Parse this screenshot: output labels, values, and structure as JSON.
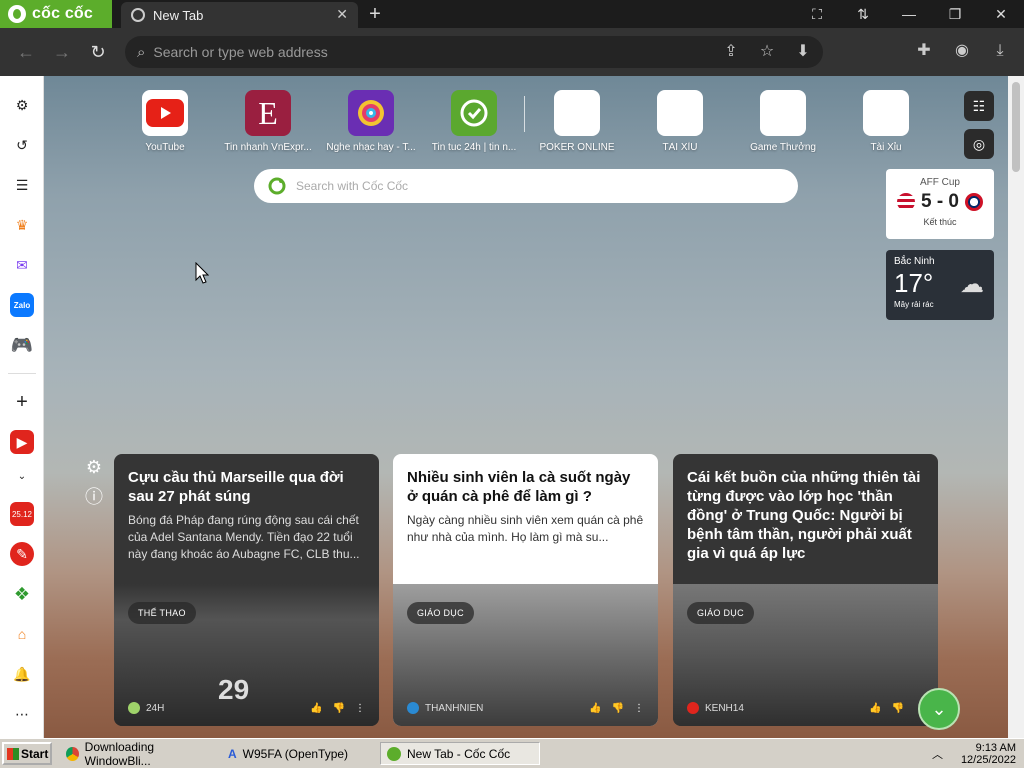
{
  "browser": {
    "brand": "cốc cốc",
    "tab_title": "New Tab",
    "tab_close": "✕",
    "new_tab": "+",
    "omnibox_placeholder": "Search or type web address"
  },
  "shortcuts": [
    {
      "label": "YouTube",
      "icon": "youtube-icon",
      "color": "#e62117"
    },
    {
      "label": "Tin nhanh VnExpr...",
      "icon": "vnexpress-icon",
      "color": "#9a1f40"
    },
    {
      "label": "Nghe nhạc hay - T...",
      "icon": "music-icon",
      "color": "#6a2eb3"
    },
    {
      "label": "Tin tuc 24h | tin n...",
      "icon": "news24h-icon",
      "color": "#5ba82f"
    },
    {
      "label": "POKER ONLINE",
      "icon": "blank-icon",
      "color": "#ffffff"
    },
    {
      "label": "TÀI XỈU",
      "icon": "blank-icon",
      "color": "#ffffff"
    },
    {
      "label": "Game Thưởng",
      "icon": "blank-icon",
      "color": "#ffffff"
    },
    {
      "label": "Tài Xỉu",
      "icon": "blank-icon",
      "color": "#ffffff"
    }
  ],
  "search": {
    "placeholder": "Search with Cốc Cốc"
  },
  "score_widget": {
    "league": "AFF Cup",
    "score": "5 - 0",
    "status": "Kết thúc"
  },
  "weather_widget": {
    "city": "Bắc Ninh",
    "temp": "17°",
    "desc": "Mây rải rác"
  },
  "cards": [
    {
      "title": "Cựu cầu thủ Marseille qua đời sau 27 phát súng",
      "excerpt": "Bóng đá Pháp đang rúng động sau cái chết của Adel Santana Mendy. Tiền đạo 22 tuổi này đang khoác áo Aubagne FC, CLB thu...",
      "tag": "THỂ THAO",
      "source": "24H",
      "style": "dark",
      "jersey": "29"
    },
    {
      "title": "Nhiều sinh viên la cà suốt ngày ở quán cà phê để làm gì ?",
      "excerpt": "Ngày càng nhiều sinh viên xem quán cà phê như nhà của mình. Họ làm gì mà su...",
      "tag": "GIÁO DỤC",
      "source": "THANHNIEN",
      "style": "light"
    },
    {
      "title": "Cái kết buồn của những thiên tài từng được vào lớp học 'thần đồng' ở Trung Quốc: Người bị bệnh tâm thần, người phải xuất gia vì quá áp lực",
      "excerpt": "",
      "tag": "GIÁO DỤC",
      "source": "KENH14",
      "style": "dark"
    }
  ],
  "taskbar": {
    "start": "Start",
    "tasks": [
      "Downloading WindowBli...",
      "W95FA (OpenType)",
      "New Tab - Cốc Cốc"
    ],
    "time": "9:13 AM",
    "date": "12/25/2022"
  },
  "colors": {
    "brand_green": "#5cad2b",
    "accent_green": "#49b54a"
  }
}
